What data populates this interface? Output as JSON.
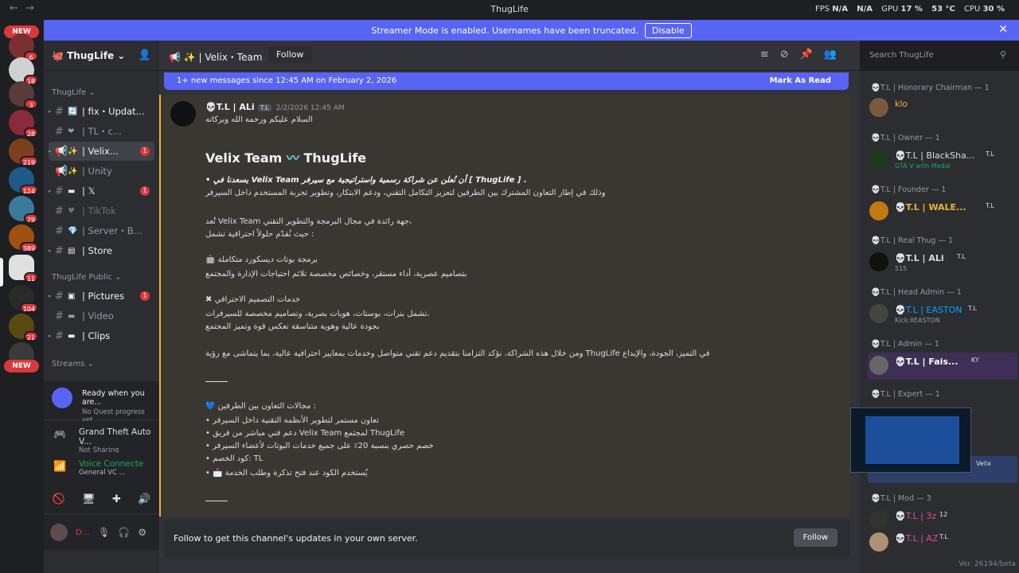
{
  "titlebar": {
    "title": "ThugLife",
    "back": "←",
    "forward": "→",
    "stats": {
      "fps": "FPS",
      "fps_val": "N/A",
      "fps_val2": "N/A",
      "gpu": "GPU",
      "gpu_val": "17 %",
      "gpu_temp": "53 °C",
      "cpu": "CPU",
      "cpu_val": "30 %"
    }
  },
  "banner": {
    "text": "Streamer Mode is enabled. Usernames have been truncated.",
    "button": "Disable"
  },
  "rail": {
    "new_top": "NEW",
    "new_bottom": "NEW",
    "badges": [
      "6",
      "18",
      "3",
      "28",
      "219",
      "124",
      "79",
      "389",
      "11",
      "104",
      "21",
      ""
    ]
  },
  "server": {
    "name": "ThugLife"
  },
  "categories": {
    "main": "ThugLife",
    "public": "ThugLife Public",
    "streams": "Streams"
  },
  "channels": [
    {
      "emoji": "🔄",
      "label": "| fix・Updat...",
      "badge": ""
    },
    {
      "emoji": "❤",
      "label": "| TL・c...",
      "badge": ""
    },
    {
      "emoji": "✨",
      "label": "| Velix...",
      "badge": "1"
    },
    {
      "emoji": "✨",
      "label": "| Unity",
      "badge": ""
    },
    {
      "emoji": "▬",
      "label": "| 𝕏",
      "badge": "1"
    },
    {
      "emoji": "♥",
      "label": "| TikTok",
      "badge": ""
    },
    {
      "emoji": "💎",
      "label": "| Server・B...",
      "badge": ""
    },
    {
      "emoji": "▤",
      "label": "| Store",
      "badge": ""
    }
  ],
  "public_channels": [
    {
      "emoji": "▣",
      "label": "| Pictures",
      "badge": "1"
    },
    {
      "emoji": "▬",
      "label": "| Video",
      "badge": ""
    },
    {
      "emoji": "▬",
      "label": "| Clips",
      "badge": ""
    }
  ],
  "quest": {
    "title": "Ready when you are...",
    "sub": "No Quest progress yet"
  },
  "game": {
    "title": "Grand Theft Auto V...",
    "sub": "Not Sharing"
  },
  "voice": {
    "title": "Voice Connecte",
    "sub": "General VC ..."
  },
  "user": {
    "name": "D..."
  },
  "channel_header": {
    "name": "✨ | Velix・Team",
    "follow": "Follow"
  },
  "search": {
    "placeholder": "Search ThugLife"
  },
  "newbar": {
    "text": "1+ new messages since 12:45 AM on February 2, 2026",
    "mark": "Mark As Read"
  },
  "message": {
    "author": "💀T.L | ALi",
    "tag": "T.L",
    "time": "2/2/2026 12:45 AM",
    "greeting": "السلام عليكم ورحمة الله وبركاته",
    "headline_a": "Velix Team",
    "headline_b": "ThugLife",
    "lines": [
      "• يسعدنا في Velix Team أن نُعلن عن شراكة رسمية واستراتيجية مع سيرفر [ ThugLife ] .",
      "وذلك في إطار التعاون المشترك بين الطرفين لتعزيز التكامل التقني، ودعم الابتكار، وتطوير تجربة المستخدم داخل السيرفر",
      "تُعد Velix Team جهة رائدة في مجال البرمجة والتطوير التقني،",
      "حيث نُقدّم حلولاً احترافية تشمل :",
      "🤖 برمجة بوتات ديسكورد متكاملة",
      "بتصاميم عصرية، أداء مستقر، وخصائص مخصصة تلائم احتياجات الإدارة والمجتمع",
      "✖ خدمات التصميم الاحترافي",
      "تشمل بنرات، بوستات، هويات بصرية، وتصاميم مخصصة للسيرفرات،",
      "بجودة عالية وهوية متناسقة تعكس قوة وتميز المجتمع",
      "ومن خلال هذه الشراكة، نؤكد التزامنا بتقديم دعم تقني متواصل وخدمات بمعايير احترافية عالية، بما يتماشى مع رؤية ThugLife في التميز، الجودة، والإبداع",
      "💙 مجالات التعاون بين الطرفين :",
      "• تعاون مستمر لتطوير الأنظمة التقنية داخل السيرفر",
      "• دعم فني مباشر من فريق Velix Team لمجتمع ThugLife",
      "• خصم حصري بنسبة 20٪ على جميع خدمات البوتات لأعضاء السيرفر",
      "• كود الخصم: TL",
      "• 📩 يُستخدم الكود عند فتح تذكرة وطلب الخدمة"
    ]
  },
  "followbar": {
    "text": "Follow to get this channel's updates in your own server.",
    "button": "Follow"
  },
  "version": "Ver. 26194/beta",
  "members": [
    {
      "group": "💀T.L | Honorary Chairman — 1",
      "name": "klo",
      "status": "",
      "tag": ""
    },
    {
      "group": "💀T.L | Owner — 1",
      "name": "💀T.L | BlackSha...",
      "status": "GTA V with Medal",
      "tag": "T.L"
    },
    {
      "group": "💀T.L | Founder — 1",
      "name": "💀T.L | WALE...",
      "status": "",
      "tag": "T.L"
    },
    {
      "group": "💀T.L | Real Thug — 1",
      "name": "💀T.L | ALi",
      "status": "515",
      "tag": "T.L"
    },
    {
      "group": "💀T.L | Head Admin — 1",
      "name": "💀T.L | EASTON",
      "status": "Kick:IIEASTON",
      "tag": "T.L"
    },
    {
      "group": "💀T.L | Admin — 1",
      "name": "💀T.L | Fais...",
      "status": "",
      "tag": "KY"
    },
    {
      "group": "💀T.L | Expert — 1",
      "name": "",
      "status": "",
      "tag": "Velix"
    },
    {
      "group": "💀T.L | Mod — 3",
      "name": "💀T.L | 3z",
      "status": "",
      "tag": "12"
    },
    {
      "group": "",
      "name": "💀T.L | AZ",
      "status": "",
      "tag": "T.L"
    }
  ]
}
